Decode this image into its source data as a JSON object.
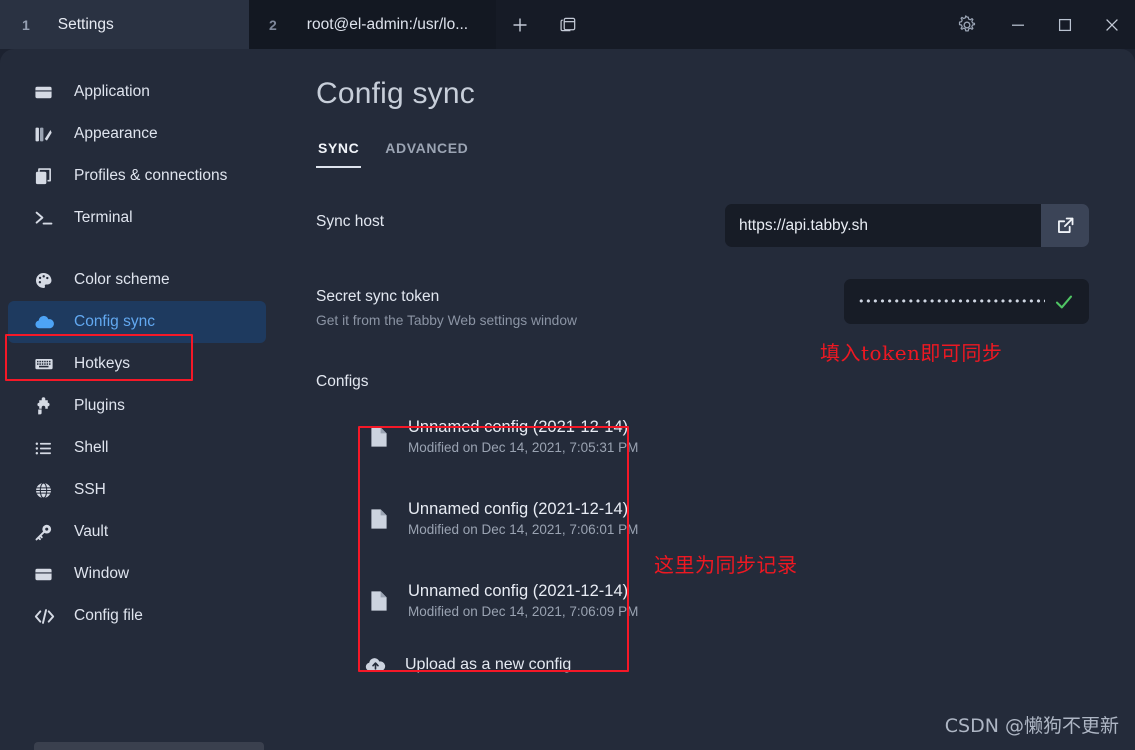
{
  "window": {
    "tabs": [
      {
        "index": "1",
        "title": "Settings",
        "active": true
      },
      {
        "index": "2",
        "title": "root@el-admin:/usr/lo...",
        "active": false
      }
    ],
    "new_tab_label": "+",
    "split_icon": "window-stack-icon",
    "controls": {
      "settings": "gear-icon",
      "minimize": "minimize-icon",
      "maximize": "maximize-icon",
      "close": "close-icon"
    }
  },
  "sidebar": {
    "items": [
      {
        "label": "Application",
        "icon": "application-icon"
      },
      {
        "label": "Appearance",
        "icon": "appearance-icon"
      },
      {
        "label": "Profiles & connections",
        "icon": "profiles-icon"
      },
      {
        "label": "Terminal",
        "icon": "terminal-icon"
      },
      {
        "label": "Color scheme",
        "icon": "palette-icon"
      },
      {
        "label": "Config sync",
        "icon": "cloud-icon",
        "active": true
      },
      {
        "label": "Hotkeys",
        "icon": "keyboard-icon"
      },
      {
        "label": "Plugins",
        "icon": "puzzle-icon"
      },
      {
        "label": "Shell",
        "icon": "list-icon"
      },
      {
        "label": "SSH",
        "icon": "globe-icon"
      },
      {
        "label": "Vault",
        "icon": "key-icon"
      },
      {
        "label": "Window",
        "icon": "window-icon"
      },
      {
        "label": "Config file",
        "icon": "code-icon"
      }
    ]
  },
  "main": {
    "title": "Config sync",
    "tabs": [
      {
        "label": "SYNC",
        "selected": true
      },
      {
        "label": "ADVANCED",
        "selected": false
      }
    ],
    "sync_host": {
      "label": "Sync host",
      "value": "https://api.tabby.sh",
      "placeholder": "",
      "open_icon": "external-link-icon"
    },
    "secret_token": {
      "label": "Secret sync token",
      "hint": "Get it from the Tabby Web settings window",
      "value": "••••••••••••••••••••••••••••••",
      "status_icon": "check-icon",
      "status_color": "#4fc463"
    },
    "configs_label": "Configs",
    "configs": [
      {
        "name": "Unnamed config (2021-12-14)",
        "meta": "Modified on Dec 14, 2021, 7:05:31 PM",
        "icon": "file-icon"
      },
      {
        "name": "Unnamed config (2021-12-14)",
        "meta": "Modified on Dec 14, 2021, 7:06:01 PM",
        "icon": "file-icon"
      },
      {
        "name": "Unnamed config (2021-12-14)",
        "meta": "Modified on Dec 14, 2021, 7:06:09 PM",
        "icon": "file-icon"
      }
    ],
    "upload": {
      "label": "Upload as a new config",
      "icon": "cloud-upload-icon"
    }
  },
  "annotations": {
    "color": "#ee1822",
    "token_note": "填入token即可同步",
    "configs_note": "这里为同步记录"
  },
  "watermark": "CSDN @懒狗不更新"
}
